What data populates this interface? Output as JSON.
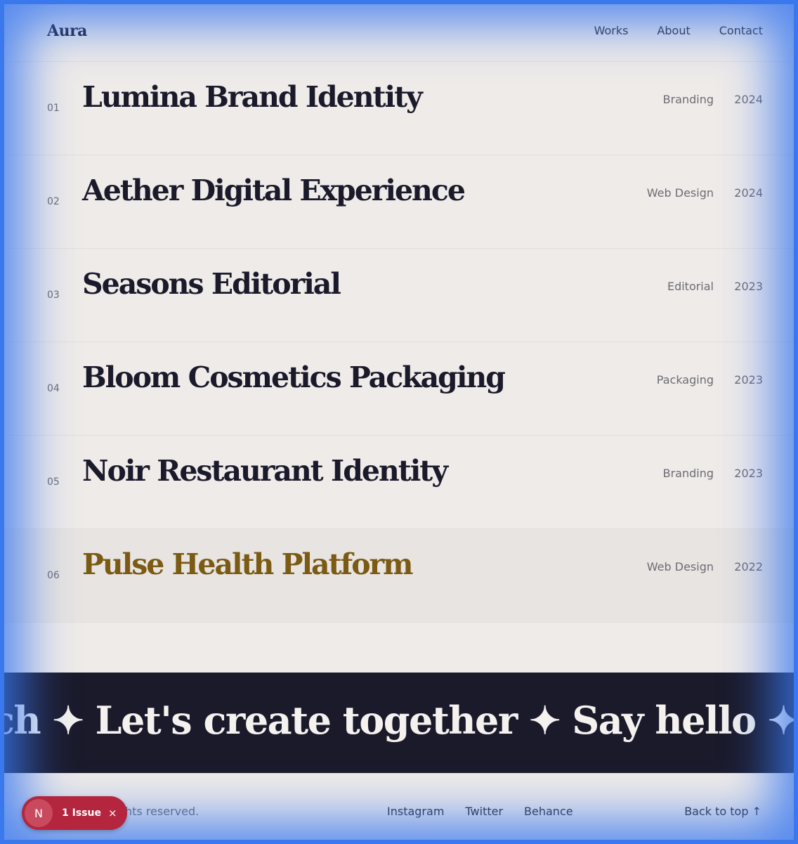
{
  "header": {
    "brand": "Aura",
    "nav": [
      "Works",
      "About",
      "Contact"
    ]
  },
  "works": [
    {
      "num": "01",
      "title": "Lumina Brand Identity",
      "category": "Branding",
      "year": "2024"
    },
    {
      "num": "02",
      "title": "Aether Digital Experience",
      "category": "Web Design",
      "year": "2024"
    },
    {
      "num": "03",
      "title": "Seasons Editorial",
      "category": "Editorial",
      "year": "2023"
    },
    {
      "num": "04",
      "title": "Bloom Cosmetics Packaging",
      "category": "Packaging",
      "year": "2023"
    },
    {
      "num": "05",
      "title": "Noir Restaurant Identity",
      "category": "Branding",
      "year": "2023"
    },
    {
      "num": "06",
      "title": "Pulse Health Platform",
      "category": "Web Design",
      "year": "2022"
    }
  ],
  "marquee": {
    "text": "ch ✦ Let's create together ✦ Say hello ✦"
  },
  "footer": {
    "copyright": "Gallery. All rights reserved.",
    "social": [
      "Instagram",
      "Twitter",
      "Behance"
    ],
    "back_to_top": "Back to top ↑"
  },
  "issue_badge": {
    "avatar": "N",
    "label": "1 Issue",
    "close": "×"
  },
  "colors": {
    "background": "#efebe9",
    "ink": "#1b1a2b",
    "accent": "#7b5a14",
    "badge": "#b3263e",
    "frame": "#3a78ee"
  }
}
